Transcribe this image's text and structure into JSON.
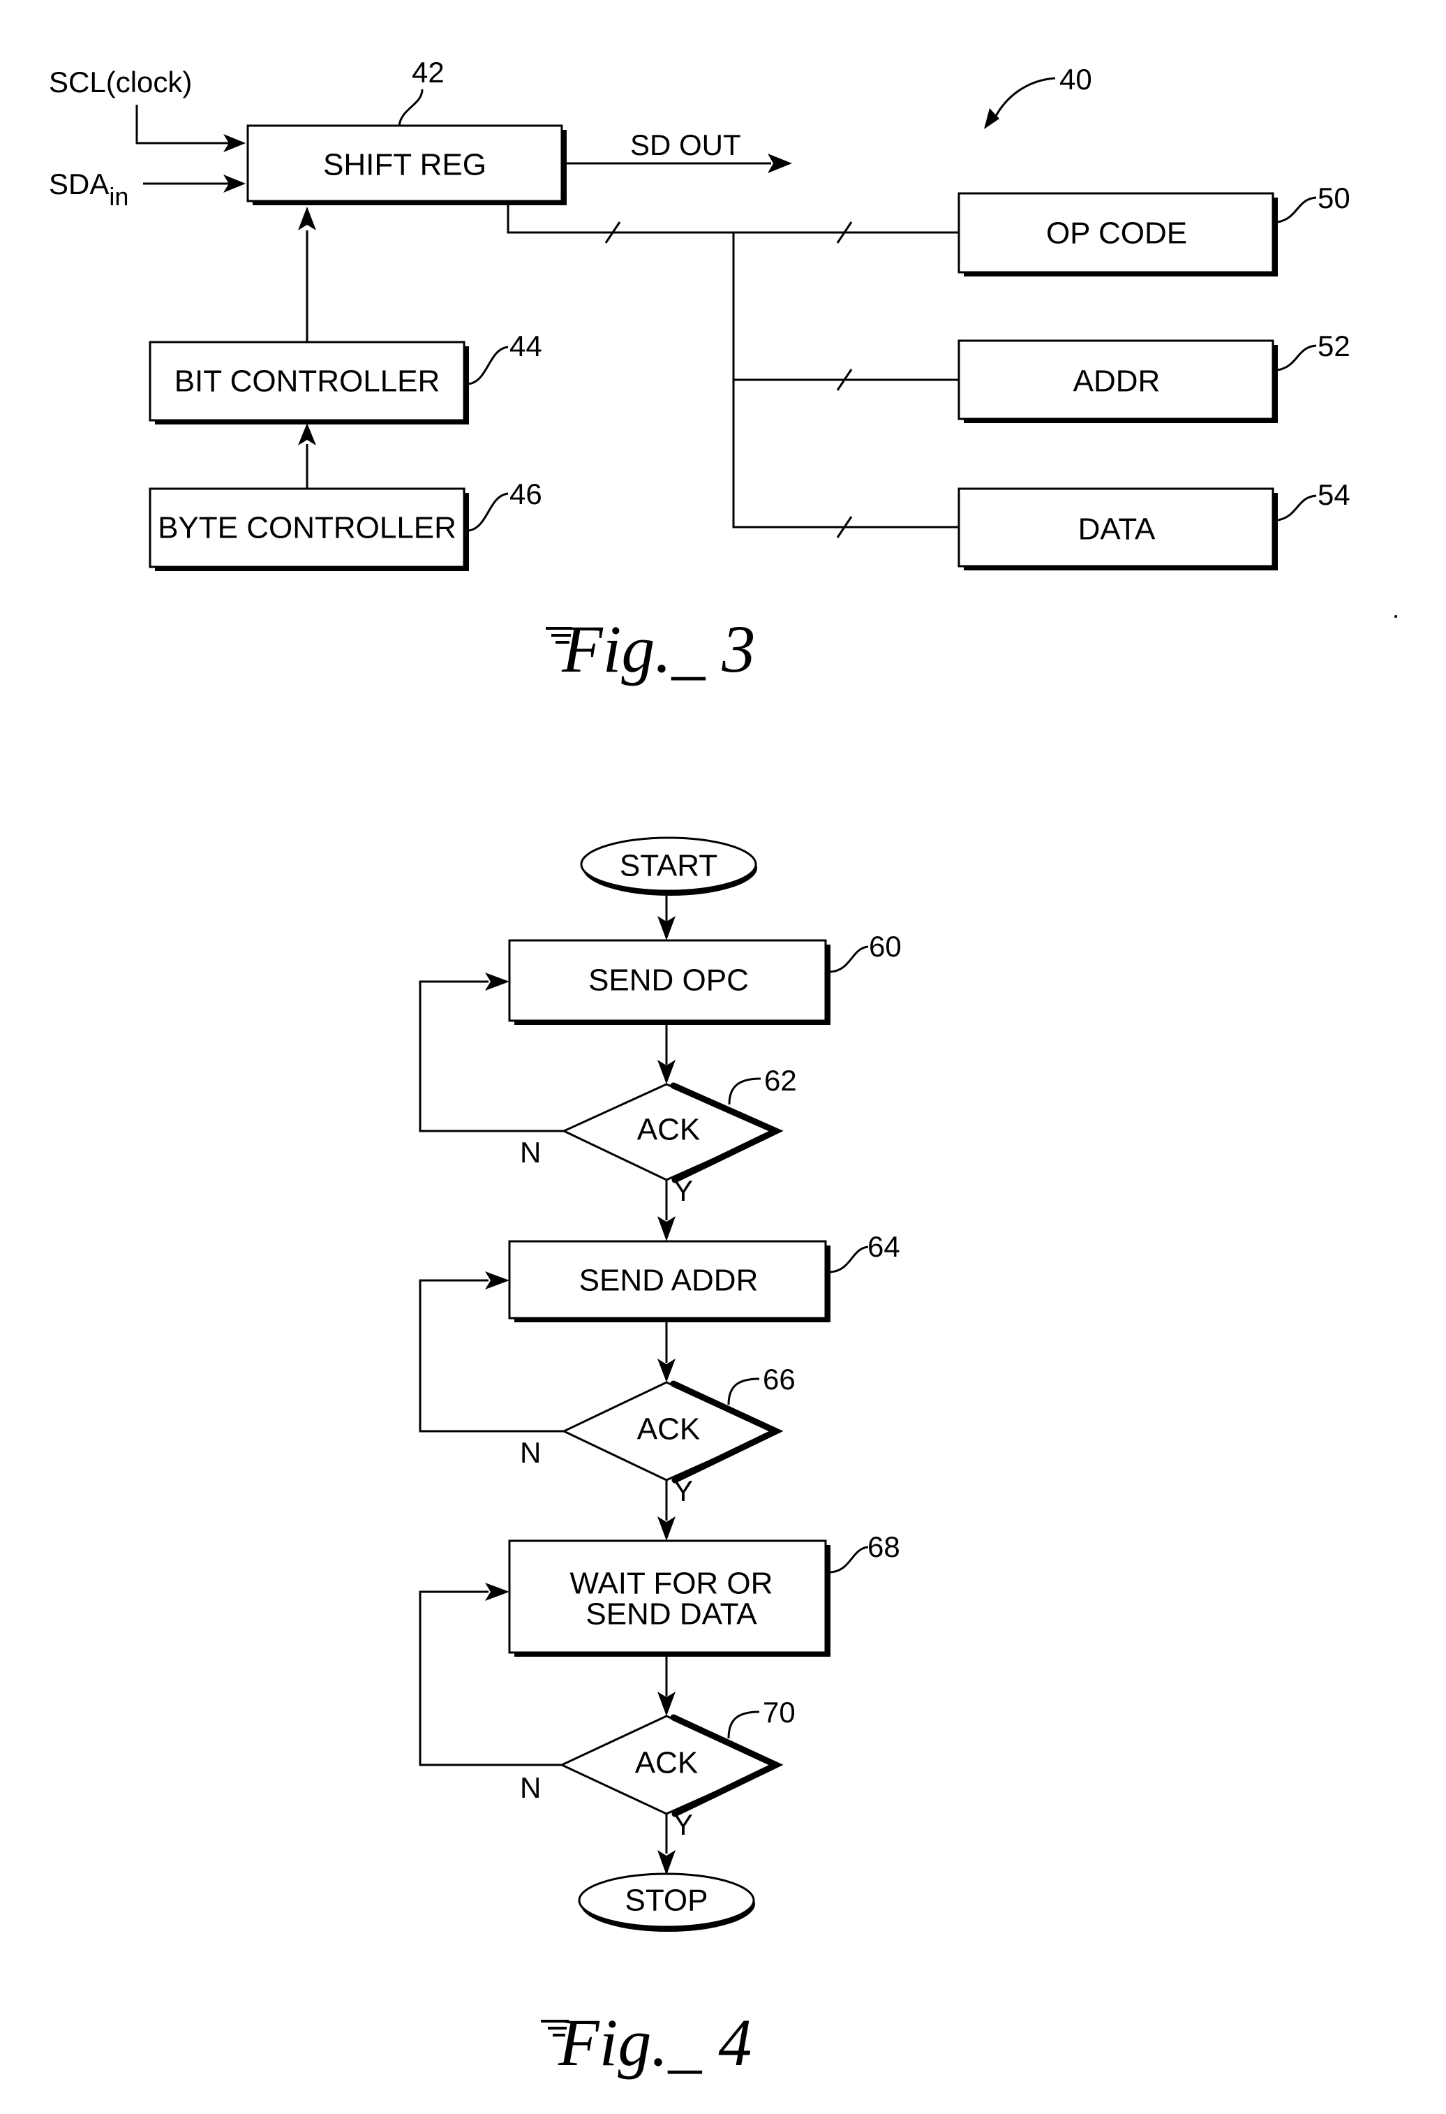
{
  "fig3": {
    "ref_system": "40",
    "inputs": {
      "scl": "SCL(clock)",
      "sda": "SDA",
      "sda_sub": "in"
    },
    "output": "SD OUT",
    "blocks": [
      {
        "id": "shift_reg",
        "label": "SHIFT REG",
        "ref": "42"
      },
      {
        "id": "bit_controller",
        "label": "BIT CONTROLLER",
        "ref": "44"
      },
      {
        "id": "byte_controller",
        "label": "BYTE CONTROLLER",
        "ref": "46"
      },
      {
        "id": "op_code",
        "label": "OP CODE",
        "ref": "50"
      },
      {
        "id": "addr",
        "label": "ADDR",
        "ref": "52"
      },
      {
        "id": "data",
        "label": "DATA",
        "ref": "54"
      }
    ],
    "caption": "Fig._ 3"
  },
  "fig4": {
    "start": "START",
    "stop": "STOP",
    "steps": [
      {
        "label": "SEND OPC",
        "ref": "60"
      },
      {
        "label": "SEND ADDR",
        "ref": "64"
      },
      {
        "label_line1": "WAIT FOR OR",
        "label_line2": "SEND DATA",
        "ref": "68"
      }
    ],
    "decisions": [
      {
        "label": "ACK",
        "ref": "62",
        "yes": "Y",
        "no": "N"
      },
      {
        "label": "ACK",
        "ref": "66",
        "yes": "Y",
        "no": "N"
      },
      {
        "label": "ACK",
        "ref": "70",
        "yes": "Y",
        "no": "N"
      }
    ],
    "caption": "Fig._ 4"
  }
}
